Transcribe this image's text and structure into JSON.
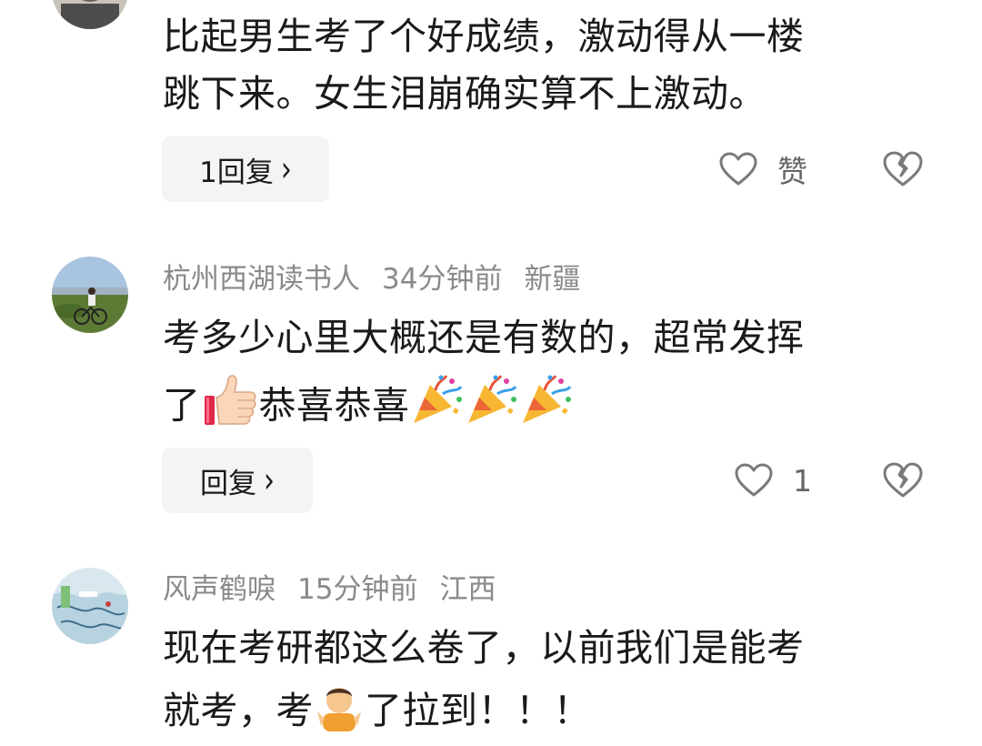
{
  "comment_1": {
    "lines": [
      "比起男生考了个好成绩，激动得从一楼",
      "跳下来。女生泪崩确实算不上激动。"
    ],
    "reply_label": "1回复",
    "like_label": "赞"
  },
  "comment_2": {
    "username": "杭州西湖读书人",
    "time": "34分钟前",
    "location": "新疆",
    "line1": "考多少心里大概还是有数的，超常发挥",
    "line2_a": "了",
    "line2_b": "恭喜恭喜",
    "reply_label": "回复",
    "like_count": "1"
  },
  "comment_3": {
    "username": "风声鹤唳",
    "time": "15分钟前",
    "location": "江西",
    "line1": "现在考研都这么卷了，以前我们是能考",
    "line2_a": "就考，考",
    "line2_b": "了拉到！！！"
  },
  "icons": {
    "reply_chevron": "chevron-right-icon",
    "like": "heart-outline-icon",
    "dislike": "broken-heart-icon",
    "thumbs_up": "thumbs-up-emoji",
    "party": "party-popper-emoji",
    "shrug": "person-gesturing-emoji"
  },
  "colors": {
    "text": "#1a1a1a",
    "meta": "#8a8a8a",
    "button_bg": "#f4f4f4",
    "icon": "#7a7a7a"
  }
}
